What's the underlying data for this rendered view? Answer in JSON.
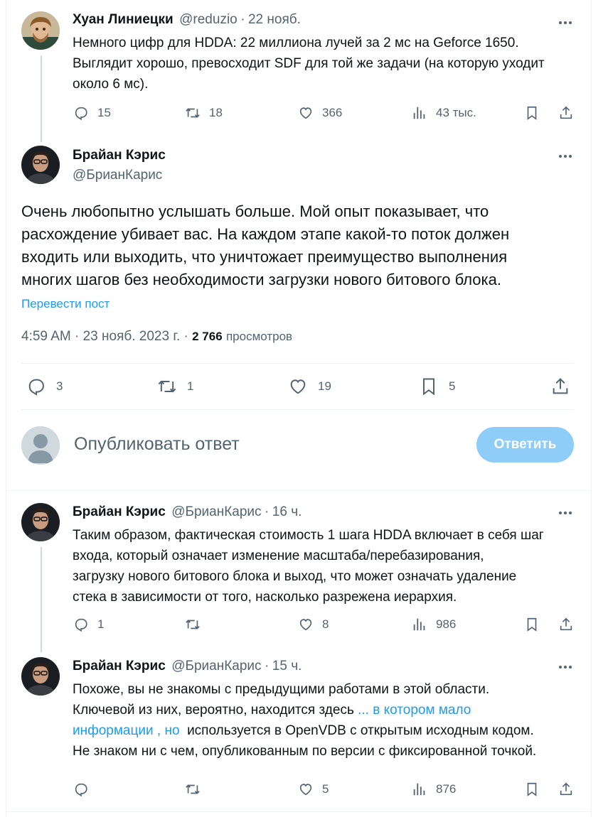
{
  "tweet1": {
    "author": "Хуан Линиецки",
    "handle": "@reduzio",
    "sep": "·",
    "date": "22 нояб.",
    "lines": [
      "Немного цифр для HDDA: 22 миллиона лучей за 2 мс на Geforce 1650.",
      "Выглядит хорошо, превосходит SDF для той же задачи (на которую уходит",
      "около 6 мс)."
    ],
    "replies": "15",
    "retweets": "18",
    "likes": "366",
    "views": "43 тыс."
  },
  "main": {
    "author": "Брайан Кэрис",
    "handle": "@БрианКарис",
    "lines": [
      "Очень любопытно услышать больше. Мой опыт показывает, что",
      "расхождение убивает вас. На каждом этапе какой-то поток должен",
      "входить или выходить, что уничтожает преимущество выполнения",
      "многих шагов без необходимости загрузки нового битового блока."
    ],
    "translate": "Перевести пост",
    "time": "4:59 AM · 23 нояб. 2023 г. ·",
    "views_count": "2 766",
    "views_label": "просмотров",
    "replies": "3",
    "retweets": "1",
    "likes": "19",
    "bookmarks": "5"
  },
  "composer": {
    "placeholder": "Опубликовать ответ",
    "button": "Ответить"
  },
  "reply1": {
    "author": "Брайан Кэрис",
    "handle": "@БрианКарис",
    "sep": "·",
    "date": "16 ч.",
    "lines": [
      "Таким образом, фактическая стоимость 1 шага HDDA включает в себя шаг",
      "входа, который означает изменение масштаба/перебазирования,",
      "загрузку нового битового блока и выход, что может означать удаление",
      "стека в зависимости от того, насколько разрежена иерархия."
    ],
    "replies": "1",
    "retweets": "",
    "likes": "8",
    "views": "986"
  },
  "reply2": {
    "author": "Брайан Кэрис",
    "handle": "@БрианКарис",
    "sep": "·",
    "date": "15 ч.",
    "line1": "Похоже, вы не знакомы с предыдущими работами в этой области.",
    "line2_text": "Ключевой из них, вероятно, находится здесь ",
    "line2_link": "... в котором мало",
    "line3_link": "информации , но",
    "line3_text": "  используется в OpenVDB с открытым исходным кодом.",
    "line4": "Не знаком ни с чем, опубликованным по версии с фиксированной точкой.",
    "replies": "",
    "retweets": "",
    "likes": "5",
    "views": "876"
  },
  "colors": {
    "accent": "#1d9bf0",
    "button_disabled": "#8ecdf8",
    "muted": "#536471",
    "divider": "#eff3f4"
  },
  "icons": [
    "reply-icon",
    "retweet-icon",
    "like-icon",
    "views-icon",
    "bookmark-icon",
    "share-icon",
    "more-icon"
  ]
}
